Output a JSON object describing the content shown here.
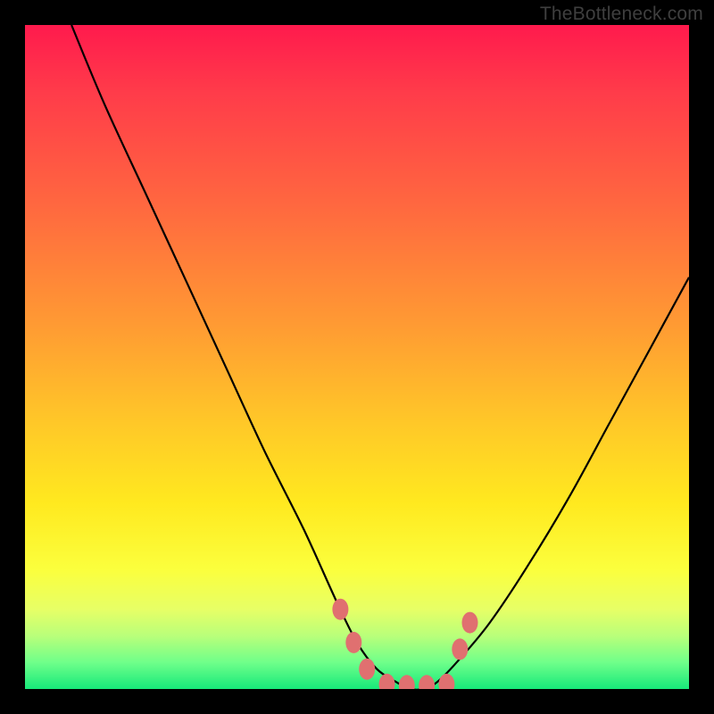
{
  "watermark": "TheBottleneck.com",
  "chart_data": {
    "type": "line",
    "title": "",
    "xlabel": "",
    "ylabel": "",
    "xlim": [
      0,
      100
    ],
    "ylim": [
      0,
      100
    ],
    "series": [
      {
        "name": "bottleneck-curve",
        "x": [
          7,
          12,
          18,
          24,
          30,
          36,
          42,
          47,
          50,
          53,
          56,
          58,
          60,
          62,
          65,
          70,
          76,
          82,
          88,
          94,
          100
        ],
        "y": [
          100,
          88,
          75,
          62,
          49,
          36,
          24,
          13,
          7,
          3,
          1,
          0,
          0,
          1,
          4,
          10,
          19,
          29,
          40,
          51,
          62
        ]
      }
    ],
    "markers": [
      {
        "x": 47.5,
        "y": 12,
        "color": "#e07070"
      },
      {
        "x": 49.5,
        "y": 7,
        "color": "#e07070"
      },
      {
        "x": 51.5,
        "y": 3,
        "color": "#e07070"
      },
      {
        "x": 54.5,
        "y": 0.7,
        "color": "#e07070"
      },
      {
        "x": 57.5,
        "y": 0.5,
        "color": "#e07070"
      },
      {
        "x": 60.5,
        "y": 0.5,
        "color": "#e07070"
      },
      {
        "x": 63.5,
        "y": 0.7,
        "color": "#e07070"
      },
      {
        "x": 65.5,
        "y": 6,
        "color": "#e07070"
      },
      {
        "x": 67.0,
        "y": 10,
        "color": "#e07070"
      }
    ],
    "background_gradient": {
      "top": "#ff1a4d",
      "mid": "#ffe91f",
      "bottom": "#17e97a"
    }
  }
}
